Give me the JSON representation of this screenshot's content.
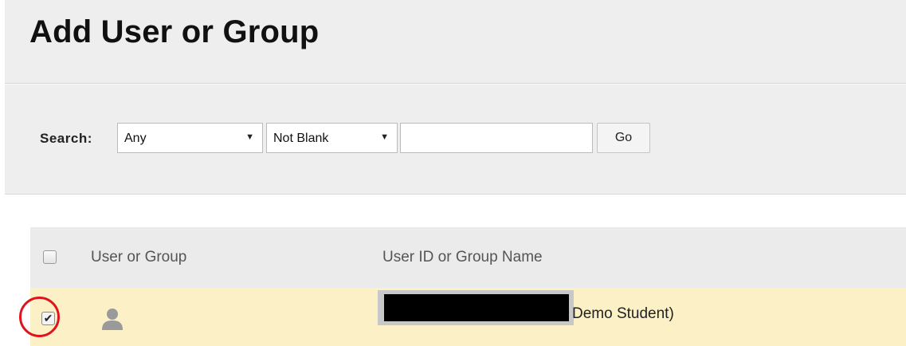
{
  "page": {
    "title": "Add User or Group"
  },
  "search": {
    "label": "Search:",
    "field_select": {
      "value": "Any"
    },
    "condition_select": {
      "value": "Not Blank"
    },
    "input": {
      "value": ""
    },
    "go_label": "Go"
  },
  "table": {
    "headers": {
      "user_or_group": "User or Group",
      "user_id_or_group_name": "User ID or Group Name"
    },
    "rows": [
      {
        "checked": true,
        "icon": "user-icon",
        "name_visible": "Demo Student)"
      }
    ]
  },
  "icons": {
    "dropdown_arrow": "▼",
    "check": "✔"
  },
  "colors": {
    "highlight_row": "#fbf0c6",
    "annotation_circle": "#e0141c"
  }
}
